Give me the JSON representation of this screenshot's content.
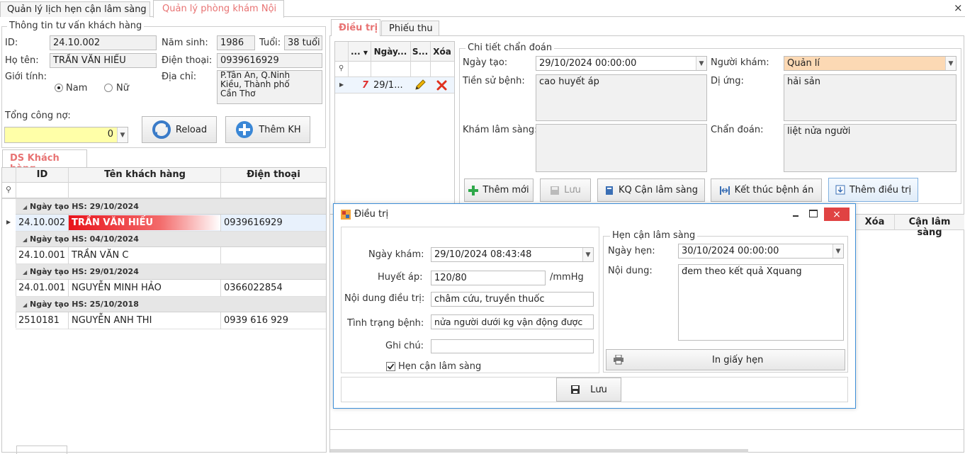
{
  "top_tabs": [
    "Quản lý lịch hẹn cận lâm sàng",
    "Quản lý phòng khám Nội"
  ],
  "close_glyph": "×",
  "customer_info": {
    "title": "Thông tin tư vấn khách hàng",
    "id_label": "ID:",
    "id_value": "24.10.002",
    "birth_year_label": "Năm sinh:",
    "birth_year": "1986",
    "age_label": "Tuổi:",
    "age": "38 tuổi",
    "name_label": "Họ tên:",
    "name": "TRẦN VĂN HIẾU",
    "phone_label": "Điện thoại:",
    "phone": "0939616929",
    "gender_label": "Giới tính:",
    "gender_male": "Nam",
    "gender_female": "Nữ",
    "address_label": "Địa chỉ:",
    "address_lines": [
      "P.Tân An, Q.Ninh",
      "Kiều, Thành phố",
      "Cần Thơ"
    ],
    "debt_label": "Tổng công nợ:",
    "debt_value": "0",
    "reload_label": "Reload",
    "add_customer_label": "Thêm KH"
  },
  "customer_list": {
    "tab": "DS Khách hàng",
    "columns": [
      "ID",
      "Tên khách hàng",
      "Điện thoại"
    ],
    "filter_glyph": "⚲",
    "groups": [
      {
        "label": "Ngày tạo HS: 29/10/2024",
        "rows": [
          {
            "id": "24.10.002",
            "name": "TRẦN VĂN HIẾU",
            "phone": "0939616929"
          }
        ]
      },
      {
        "label": "Ngày tạo HS: 04/10/2024",
        "rows": [
          {
            "id": "24.10.001",
            "name": "TRẦN VĂN C",
            "phone": ""
          }
        ]
      },
      {
        "label": "Ngày tạo HS: 29/01/2024",
        "rows": [
          {
            "id": "24.01.001",
            "name": "NGUYỄN MINH HẢO",
            "phone": "0366022854"
          }
        ]
      },
      {
        "label": "Ngày tạo HS: 25/10/2018",
        "rows": [
          {
            "id": "2510181",
            "name": "NGUYỄN ANH THI",
            "phone": "0939 616 929"
          }
        ]
      }
    ]
  },
  "treatment_tabs": [
    "Điều trị",
    "Phiếu thu"
  ],
  "visit_grid": {
    "columns": [
      "...",
      "Ngày...",
      "S...",
      "Xóa"
    ],
    "row": {
      "num": "7",
      "date": "29/1..."
    }
  },
  "diagnosis": {
    "title": "Chi tiết chẩn đoán",
    "created_label": "Ngày tạo:",
    "created_value": "29/10/2024 00:00:00",
    "doctor_label": "Người khám:",
    "doctor_value": "Quản lí",
    "history_label": "Tiền sử bệnh:",
    "history_value": "cao huyết áp",
    "allergy_label": "Dị ứng:",
    "allergy_value": "hải sản",
    "clinical_label": "Khám lâm sàng:",
    "clinical_value": "",
    "diagnosis_label": "Chẩn đoán:",
    "diagnosis_value": "liệt nửa người",
    "buttons": [
      "Thêm mới",
      "Lưu",
      "KQ Cận lâm sàng",
      "Kết thúc bệnh án",
      "Thêm điều trị"
    ]
  },
  "lower_grid_columns": [
    "Xóa",
    "Cận lâm sàng"
  ],
  "dialog": {
    "title": "Điều trị",
    "exam_date_label": "Ngày khám:",
    "exam_date": "29/10/2024 08:43:48",
    "bp_label": "Huyết áp:",
    "bp_value": "120/80",
    "bp_unit": "/mmHg",
    "treatment_label": "Nội dung điều trị:",
    "treatment_value": "châm cứu, truyền thuốc",
    "condition_label": "Tình trạng bệnh:",
    "condition_value": "nửa người dưới kg vận động được",
    "note_label": "Ghi chú:",
    "note_value": "",
    "appointment_checkbox": "Hẹn cận lâm sàng",
    "appointment_group": "Hẹn cận lâm sàng",
    "appt_date_label": "Ngày hẹn:",
    "appt_date": "30/10/2024 00:00:00",
    "content_label": "Nội dung:",
    "content_value": "đem theo kết quả Xquang",
    "print_label": "In giấy hẹn",
    "save_label": "Lưu"
  }
}
